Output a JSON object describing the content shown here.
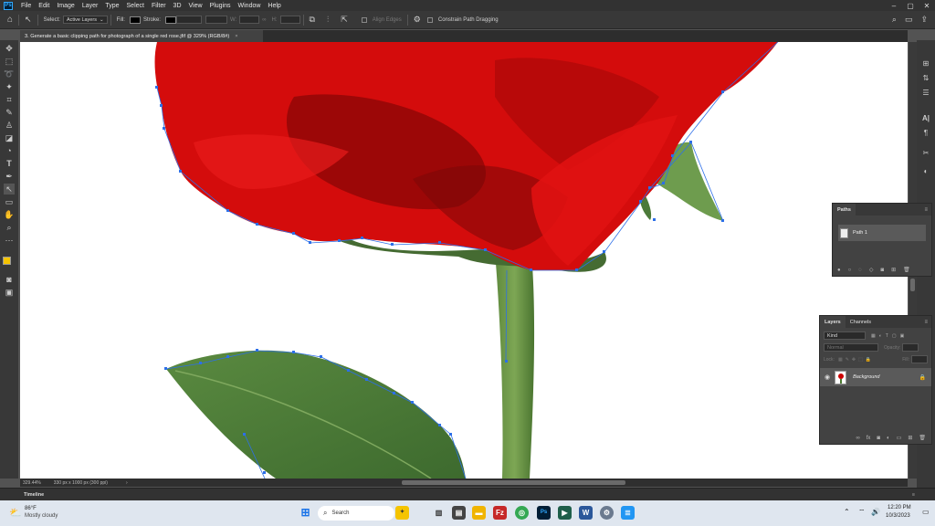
{
  "menubar": {
    "logo": "Ps",
    "items": [
      "File",
      "Edit",
      "Image",
      "Layer",
      "Type",
      "Select",
      "Filter",
      "3D",
      "View",
      "Plugins",
      "Window",
      "Help"
    ]
  },
  "options": {
    "select_label": "Select:",
    "select_value": "Active Layers",
    "fill_label": "Fill:",
    "stroke_label": "Stroke:",
    "w_label": "W:",
    "h_label": "H:",
    "align_edges": "Align Edges",
    "constrain": "Constrain Path Dragging"
  },
  "document": {
    "tab_title": "3. Generate a basic clipping path for photograph of a single red rose.jfif @ 329% (RGB/8#)",
    "close": "×"
  },
  "status": {
    "zoom": "329.44%",
    "doc_info": "330 px x 1000 px (300 ppi)"
  },
  "timeline": {
    "label": "Timeline"
  },
  "paths_panel": {
    "tab": "Paths",
    "menu": "≡",
    "item": "Path 1"
  },
  "layers_panel": {
    "tabs": [
      "Layers",
      "Channels"
    ],
    "menu": "≡",
    "kind": "Kind",
    "blend": "Normal",
    "opacity_label": "Opacity:",
    "lock_label": "Lock:",
    "fill_label": "Fill:",
    "layer_name": "Background"
  },
  "taskbar": {
    "weather_temp": "86°F",
    "weather_desc": "Mostly cloudy",
    "search": "Search",
    "time": "12:20 PM",
    "date": "10/3/2023"
  },
  "colors": {
    "rose_red": "#d40c0c",
    "leaf_green": "#4c7a3a",
    "path_anchor": "#2d6fe8",
    "foreground": "#f5c400"
  }
}
